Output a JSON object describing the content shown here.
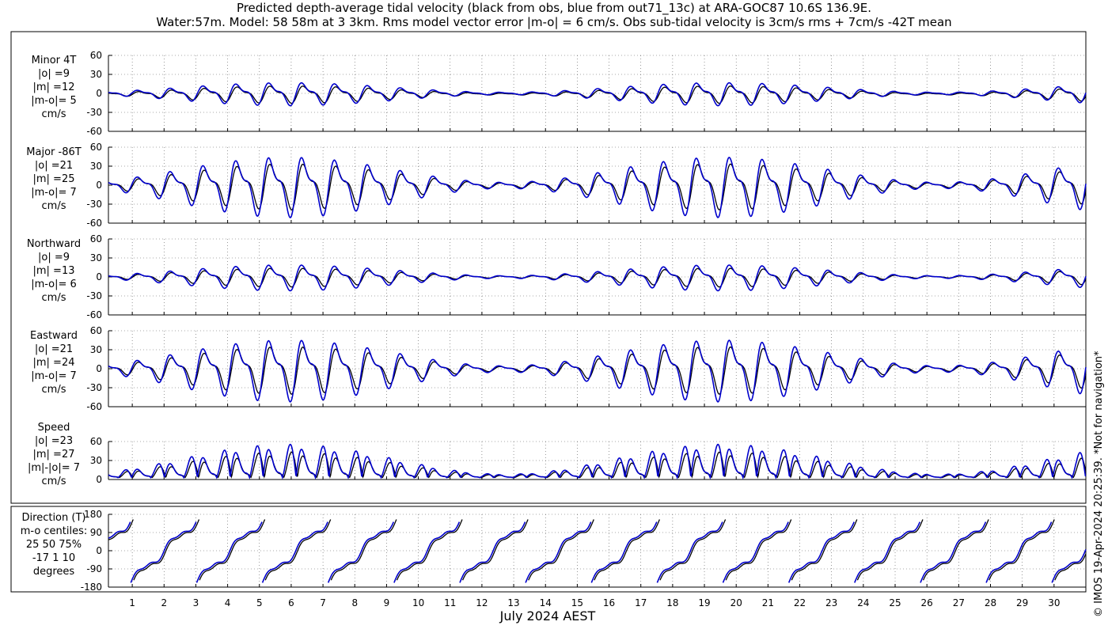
{
  "title_line1": "Predicted depth-average tidal velocity (black from obs, blue from out71_13c) at ARA-GOC87 10.6S 136.9E.",
  "title_line2": "Water:57m. Model: 58 58m at 3 3km. Rms model vector error |m-o| = 6 cm/s. Obs sub-tidal velocity is 3cm/s rms + 7cm/s -42T mean",
  "side_note": "© IMOS 19-Apr-2024 20:25:39. *Not for navigation*",
  "colors": {
    "obs": "#000000",
    "model": "#0000cc",
    "axis": "#000000",
    "grid": "#555555"
  },
  "chart_data": {
    "type": "line",
    "xlabel": "July 2024 AEST",
    "x_days": [
      1,
      2,
      3,
      4,
      5,
      6,
      7,
      8,
      9,
      10,
      11,
      12,
      13,
      14,
      15,
      16,
      17,
      18,
      19,
      20,
      21,
      22,
      23,
      24,
      25,
      26,
      27,
      28,
      29,
      30
    ],
    "xlim": [
      0.25,
      31.0
    ],
    "series_names": [
      "obs",
      "out71_13c"
    ],
    "panels": [
      {
        "id": "minor",
        "label_lines": [
          "Minor 4T",
          "|o| =9",
          "|m| =12",
          "|m-o|= 5",
          "cm/s"
        ],
        "ylim": [
          -60,
          60
        ],
        "yticks": [
          -60,
          -30,
          0,
          30,
          60
        ],
        "kind": "velocity",
        "amp_obs": 12,
        "amp_model": 16,
        "mean_obs": -1,
        "mean_model": 0
      },
      {
        "id": "major",
        "label_lines": [
          "Major -86T",
          "|o| =21",
          "|m| =25",
          "|m-o|= 7",
          "cm/s"
        ],
        "ylim": [
          -60,
          60
        ],
        "yticks": [
          -60,
          -30,
          0,
          30,
          60
        ],
        "kind": "velocity",
        "amp_obs": 32,
        "amp_model": 42,
        "mean_obs": 0,
        "mean_model": 0
      },
      {
        "id": "northward",
        "label_lines": [
          "Northward",
          "|o| =9",
          "|m| =13",
          "|m-o|= 6",
          "cm/s"
        ],
        "ylim": [
          -60,
          60
        ],
        "yticks": [
          -60,
          -30,
          0,
          30,
          60
        ],
        "kind": "velocity",
        "amp_obs": 13,
        "amp_model": 18,
        "mean_obs": 0,
        "mean_model": 0
      },
      {
        "id": "eastward",
        "label_lines": [
          "Eastward",
          "|o| =21",
          "|m| =24",
          "|m-o|= 7",
          "cm/s"
        ],
        "ylim": [
          -60,
          60
        ],
        "yticks": [
          -60,
          -30,
          0,
          30,
          60
        ],
        "kind": "velocity",
        "amp_obs": 33,
        "amp_model": 43,
        "mean_obs": 0,
        "mean_model": 0
      },
      {
        "id": "speed",
        "label_lines": [
          "Speed",
          "|o| =23",
          "|m| =27",
          "|m|-|o|= 7",
          "cm/s"
        ],
        "ylim": [
          0,
          60
        ],
        "yticks": [
          0,
          30,
          60
        ],
        "kind": "speed",
        "amp_obs": 36,
        "amp_model": 47,
        "mean_obs": 0,
        "mean_model": 0
      },
      {
        "id": "direction",
        "label_lines": [
          "Direction (T)",
          "m-o centiles:",
          "25  50  75%",
          "-17   1  10",
          "degrees"
        ],
        "ylim": [
          -180,
          180
        ],
        "yticks": [
          -180,
          -90,
          0,
          90,
          180
        ],
        "kind": "direction",
        "amp_obs": 90,
        "amp_model": 90,
        "mean_obs": 0,
        "mean_model": 0
      }
    ]
  }
}
